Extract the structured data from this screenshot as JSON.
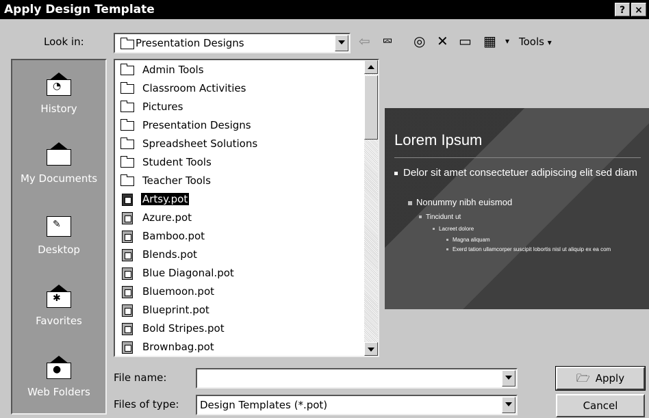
{
  "window": {
    "title": "Apply Design Template",
    "help_label": "?",
    "close_label": "×"
  },
  "lookin": {
    "label": "Look in:",
    "value": "Presentation Designs"
  },
  "toolbar": {
    "tools_label": "Tools"
  },
  "places": [
    {
      "label": "History",
      "icon": "history-icon"
    },
    {
      "label": "My Documents",
      "icon": "my-documents-icon"
    },
    {
      "label": "Desktop",
      "icon": "desktop-icon"
    },
    {
      "label": "Favorites",
      "icon": "favorites-icon"
    },
    {
      "label": "Web Folders",
      "icon": "web-folders-icon"
    }
  ],
  "files": [
    {
      "name": "Admin Tools",
      "type": "folder"
    },
    {
      "name": "Classroom Activities",
      "type": "folder"
    },
    {
      "name": "Pictures",
      "type": "folder"
    },
    {
      "name": "Presentation Designs",
      "type": "folder"
    },
    {
      "name": "Spreadsheet Solutions",
      "type": "folder"
    },
    {
      "name": "Student Tools",
      "type": "folder"
    },
    {
      "name": "Teacher Tools",
      "type": "folder"
    },
    {
      "name": "Artsy.pot",
      "type": "pot",
      "selected": true
    },
    {
      "name": "Azure.pot",
      "type": "pot"
    },
    {
      "name": "Bamboo.pot",
      "type": "pot"
    },
    {
      "name": "Blends.pot",
      "type": "pot"
    },
    {
      "name": "Blue Diagonal.pot",
      "type": "pot"
    },
    {
      "name": "Bluemoon.pot",
      "type": "pot"
    },
    {
      "name": "Blueprint.pot",
      "type": "pot"
    },
    {
      "name": "Bold Stripes.pot",
      "type": "pot"
    },
    {
      "name": "Brownbag.pot",
      "type": "pot"
    }
  ],
  "preview": {
    "title": "Lorem Ipsum",
    "bullet1": "Delor sit amet consectetuer adipiscing elit sed diam",
    "bullet2": "Nonummy nibh euismod",
    "bullet3": "Tincidunt ut",
    "bullet4": "Lacreet dolore",
    "bullet5": "Magna aliquam",
    "bullet6": "Exerd tation ullamcorper suscipit lobortis nisl ut aliquip ex ea com"
  },
  "filename": {
    "label": "File name:",
    "value": ""
  },
  "filetype": {
    "label": "Files of type:",
    "value": "Design Templates (*.pot)"
  },
  "buttons": {
    "apply": "Apply",
    "cancel": "Cancel"
  }
}
